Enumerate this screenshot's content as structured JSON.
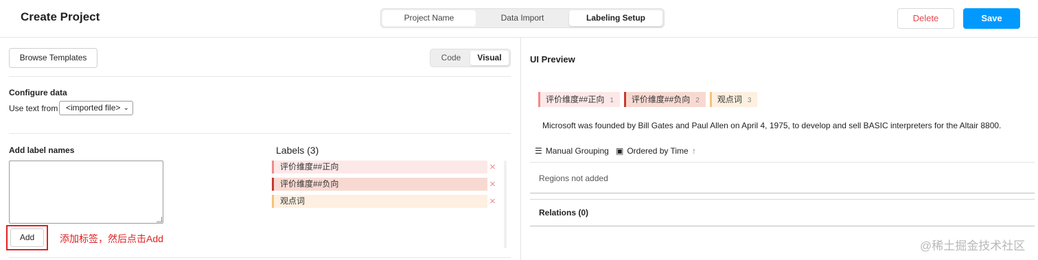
{
  "header": {
    "title": "Create Project",
    "steps": [
      "Project Name",
      "Data Import",
      "Labeling Setup"
    ],
    "active_step": "Labeling Setup",
    "delete_label": "Delete",
    "save_label": "Save"
  },
  "colors": {
    "primary": "#0099ff",
    "danger": "#e5484d",
    "annotation": "#e02020",
    "label1_border": "#f08a8a",
    "label1_bg": "#fde8e8",
    "label2_border": "#c83a2e",
    "label2_bg": "#f8d9d2",
    "label3_border": "#f5c27a",
    "label3_bg": "#fdf0e0"
  },
  "left": {
    "browse_templates": "Browse Templates",
    "modes": [
      "Code",
      "Visual"
    ],
    "active_mode": "Visual",
    "configure_title": "Configure data",
    "use_text_from": "Use text from",
    "source_select": "<imported file>",
    "add_label_names": "Add label names",
    "add_button": "Add",
    "annotation": "添加标签，然后点击Add",
    "labels_title": "Labels (3)",
    "labels": [
      {
        "text": "评价维度##正向",
        "remove_icon": "×"
      },
      {
        "text": "评价维度##负向",
        "remove_icon": "×"
      },
      {
        "text": "观点词",
        "remove_icon": "×"
      }
    ]
  },
  "preview": {
    "title": "UI Preview",
    "chips": [
      {
        "text": "评价维度##正向",
        "hotkey": "1"
      },
      {
        "text": "评价维度##负向",
        "hotkey": "2"
      },
      {
        "text": "观点词",
        "hotkey": "3"
      }
    ],
    "sample_text": "Microsoft was founded by Bill Gates and Paul Allen on April 4, 1975, to develop and sell BASIC interpreters for the Altair 8800.",
    "manual_grouping": "Manual Grouping",
    "ordered_by_time": "Ordered by Time",
    "regions_empty": "Regions not added",
    "relations": "Relations (0)"
  },
  "watermark": "@稀土掘金技术社区"
}
